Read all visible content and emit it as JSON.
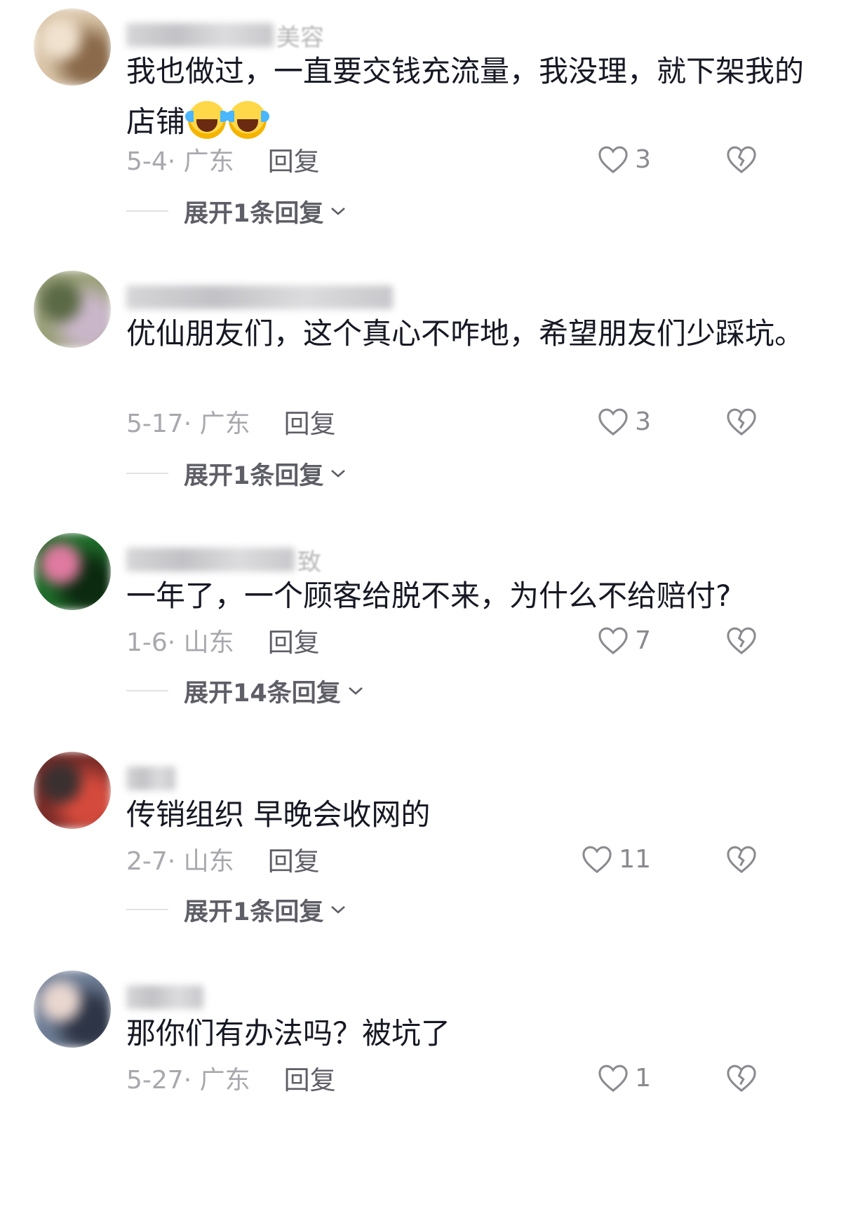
{
  "comments": [
    {
      "username": "美容",
      "text": "我也做过，一直要交钱充流量，我没理，就下架我的店铺",
      "emoji_count": 2,
      "date_location": "5-4· 广东",
      "reply_label": "回复",
      "likes": "3",
      "expand_label": "展开1条回复",
      "avatar_colors": [
        "#d9c4a8",
        "#8a6a4a",
        "#f0e2cf"
      ]
    },
    {
      "username": "",
      "text": "优仙朋友们，这个真心不咋地，希望朋友们少踩坑。",
      "emoji_count": 0,
      "date_location": "5-17· 广东",
      "reply_label": "回复",
      "likes": "3",
      "expand_label": "展开1条回复",
      "avatar_colors": [
        "#9aa07a",
        "#c9b6c8",
        "#5b6a46"
      ]
    },
    {
      "username": "致",
      "text": "一年了，一个顾客给脱不来，为什么不给赔付?",
      "emoji_count": 0,
      "date_location": "1-6· 山东",
      "reply_label": "回复",
      "likes": "7",
      "expand_label": "展开14条回复",
      "avatar_colors": [
        "#1f6b2a",
        "#0c2a10",
        "#e07aa0"
      ]
    },
    {
      "username": "",
      "text": "传销组织 早晚会收网的",
      "emoji_count": 0,
      "date_location": "2-7· 山东",
      "reply_label": "回复",
      "likes": "11",
      "expand_label": "展开1条回复",
      "avatar_colors": [
        "#7a2c28",
        "#d44a3c",
        "#3a3030"
      ]
    },
    {
      "username": "",
      "text": "那你们有办法吗？被坑了",
      "emoji_count": 0,
      "date_location": "5-27· 广东",
      "reply_label": "回复",
      "likes": "1",
      "expand_label": "",
      "avatar_colors": [
        "#6f7e96",
        "#2e3546",
        "#e8d6cf"
      ]
    }
  ],
  "colors": {
    "text": "#161823",
    "meta": "#a8a8ad",
    "reply": "#5e5e66",
    "icon": "#8a8a8f"
  }
}
